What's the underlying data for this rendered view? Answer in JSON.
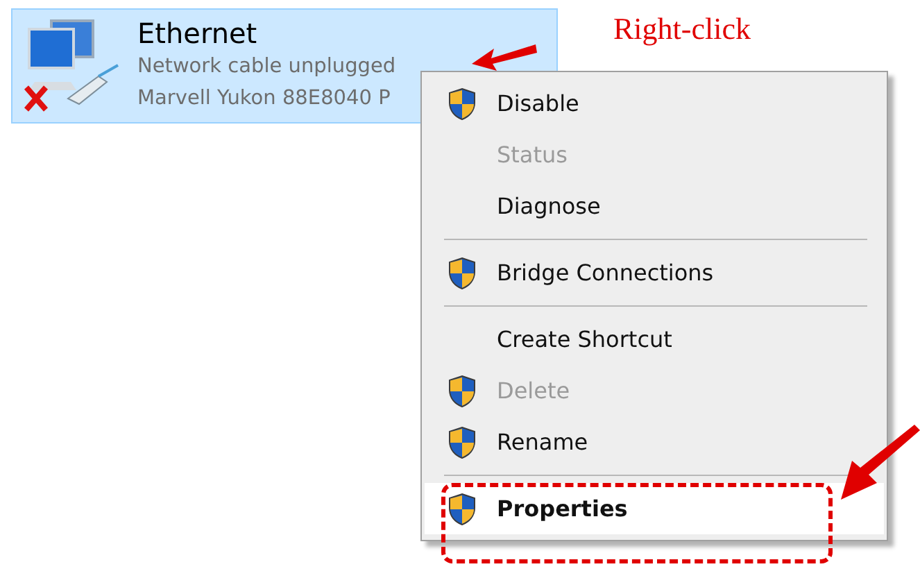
{
  "adapter": {
    "name": "Ethernet",
    "status": "Network cable unplugged",
    "device": "Marvell Yukon 88E8040 P",
    "selected": true
  },
  "annotation": {
    "label": "Right-click"
  },
  "context_menu": {
    "items": [
      {
        "kind": "item",
        "label": "Disable",
        "shield": true,
        "disabled": false,
        "selected": false,
        "default": false
      },
      {
        "kind": "item",
        "label": "Status",
        "shield": false,
        "disabled": true,
        "selected": false,
        "default": false
      },
      {
        "kind": "item",
        "label": "Diagnose",
        "shield": false,
        "disabled": false,
        "selected": false,
        "default": false
      },
      {
        "kind": "separator"
      },
      {
        "kind": "item",
        "label": "Bridge Connections",
        "shield": true,
        "disabled": false,
        "selected": false,
        "default": false
      },
      {
        "kind": "separator"
      },
      {
        "kind": "item",
        "label": "Create Shortcut",
        "shield": false,
        "disabled": false,
        "selected": false,
        "default": false
      },
      {
        "kind": "item",
        "label": "Delete",
        "shield": true,
        "disabled": true,
        "selected": false,
        "default": false
      },
      {
        "kind": "item",
        "label": "Rename",
        "shield": true,
        "disabled": false,
        "selected": false,
        "default": false
      },
      {
        "kind": "separator"
      },
      {
        "kind": "item",
        "label": "Properties",
        "shield": true,
        "disabled": false,
        "selected": true,
        "default": true
      }
    ]
  }
}
